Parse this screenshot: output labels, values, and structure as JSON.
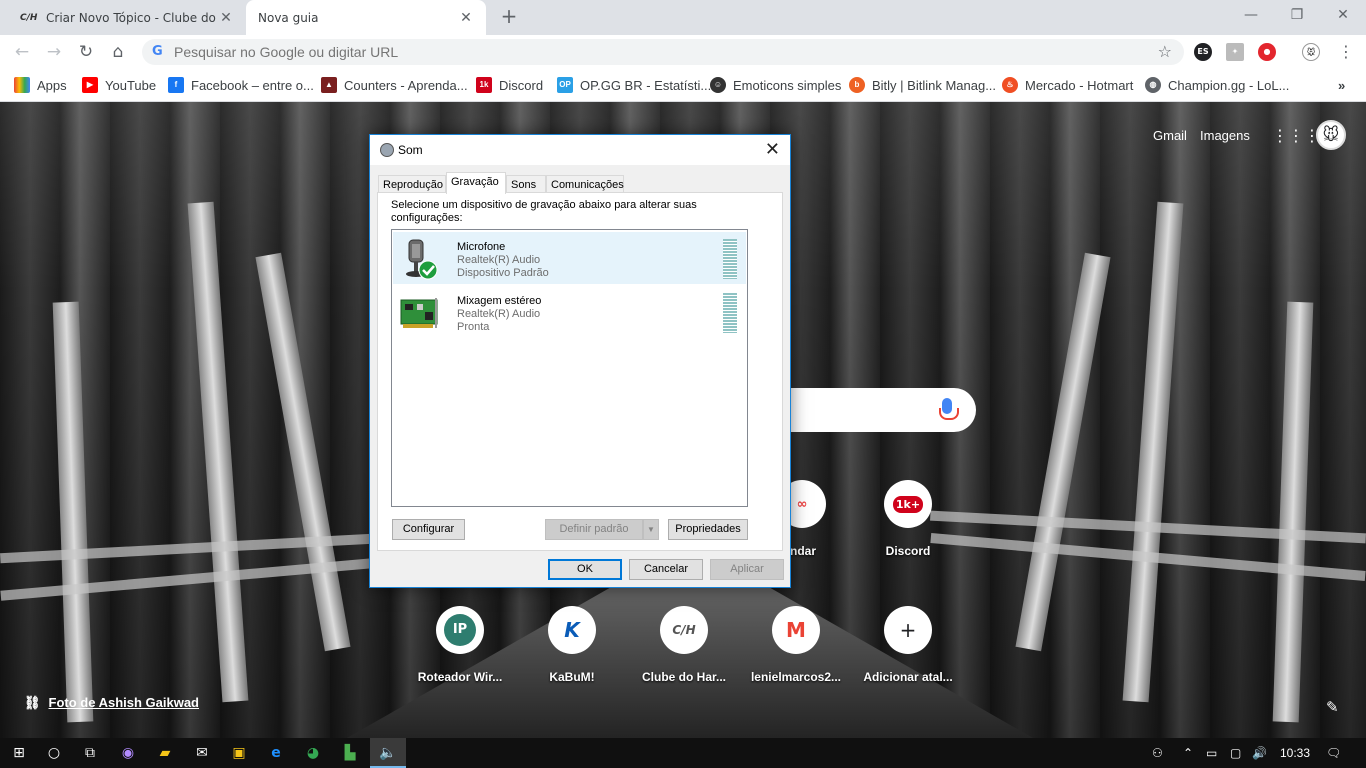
{
  "browser": {
    "tabs": [
      {
        "label": "Criar Novo Tópico - Clube do Har",
        "favicon": "C/H"
      },
      {
        "label": "Nova guia"
      }
    ],
    "window_controls": {
      "minimize": "—",
      "restore": "❐",
      "close": "✕"
    },
    "omnibox_placeholder": "Pesquisar no Google ou digitar URL",
    "extensions": [
      "ES",
      "✦",
      "●",
      "🐭"
    ],
    "bookmarks": [
      {
        "label": "Apps",
        "icon": "apps-grid-icon",
        "color": "#ea4335"
      },
      {
        "label": "YouTube",
        "icon": "youtube-icon",
        "color": "#ff0000"
      },
      {
        "label": "Facebook – entre o...",
        "icon": "facebook-icon",
        "color": "#1877f2"
      },
      {
        "label": "Counters - Aprenda...",
        "icon": "counters-icon",
        "color": "#7a1f1f"
      },
      {
        "label": "Discord",
        "icon": "discord-icon",
        "color": "#d0021b"
      },
      {
        "label": "OP.GG BR - Estatísti...",
        "icon": "opgg-icon",
        "color": "#2aa0e6"
      },
      {
        "label": "Emoticons simples",
        "icon": "emoticon-icon",
        "color": "#333333"
      },
      {
        "label": "Bitly | Bitlink Manag...",
        "icon": "bitly-icon",
        "color": "#ee6123"
      },
      {
        "label": "Mercado - Hotmart",
        "icon": "hotmart-icon",
        "color": "#f04e23"
      },
      {
        "label": "Champion.gg - LoL...",
        "icon": "globe-icon",
        "color": "#5f6368"
      }
    ],
    "bookmarks_overflow": "»"
  },
  "ntp": {
    "gmail": "Gmail",
    "images": "Imagens",
    "tiles_row1": [
      {
        "label": "ndar",
        "glyph": "∞"
      },
      {
        "label": "Discord",
        "glyph": "1k+"
      }
    ],
    "tiles_row2": [
      {
        "label": "Roteador Wir...",
        "glyph": "IP"
      },
      {
        "label": "KaBuM!",
        "glyph": "K"
      },
      {
        "label": "Clube do Har...",
        "glyph": "C/H"
      },
      {
        "label": "lenielmarcos2...",
        "glyph": "M"
      },
      {
        "label": "Adicionar atal...",
        "glyph": "+"
      }
    ],
    "photo_credit": "Foto de Ashish Gaikwad"
  },
  "dialog": {
    "title": "Som",
    "tabs": [
      "Reprodução",
      "Gravação",
      "Sons",
      "Comunicações"
    ],
    "active_tab": "Gravação",
    "description": "Selecione um dispositivo de gravação abaixo para alterar suas configurações:",
    "devices": [
      {
        "name": "Microfone",
        "driver": "Realtek(R) Audio",
        "status": "Dispositivo Padrão",
        "selected": true,
        "default": true
      },
      {
        "name": "Mixagem estéreo",
        "driver": "Realtek(R) Audio",
        "status": "Pronta",
        "selected": false
      }
    ],
    "buttons": {
      "configure": "Configurar",
      "set_default": "Definir padrão",
      "properties": "Propriedades",
      "ok": "OK",
      "cancel": "Cancelar",
      "apply": "Aplicar"
    }
  },
  "taskbar": {
    "clock": "10:33"
  }
}
